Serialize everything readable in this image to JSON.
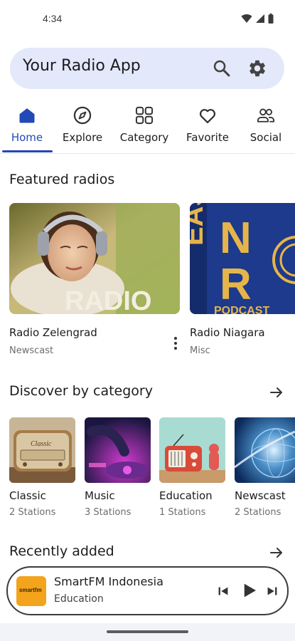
{
  "status_bar": {
    "time": "4:34",
    "icons": [
      "wifi-icon",
      "cell-signal-icon",
      "battery-icon"
    ]
  },
  "search": {
    "title": "Your Radio App",
    "icons": [
      "search-icon",
      "gear-icon"
    ]
  },
  "tabs": [
    {
      "label": "Home",
      "icon": "home-icon",
      "active": true
    },
    {
      "label": "Explore",
      "icon": "compass-icon",
      "active": false
    },
    {
      "label": "Category",
      "icon": "grid-icon",
      "active": false
    },
    {
      "label": "Favorite",
      "icon": "heart-icon",
      "active": false
    },
    {
      "label": "Social",
      "icon": "people-icon",
      "active": false
    }
  ],
  "featured": {
    "title": "Featured radios",
    "items": [
      {
        "name": "Radio Zelengrad",
        "category": "Newscast",
        "image_text": "RADIO"
      },
      {
        "name": "Radio Niagara",
        "category": "Misc",
        "image_text": "EAST N R PODCAST"
      }
    ]
  },
  "categories": {
    "title": "Discover by category",
    "items": [
      {
        "name": "Classic",
        "count": "2 Stations"
      },
      {
        "name": "Music",
        "count": "3 Stations"
      },
      {
        "name": "Education",
        "count": "1 Stations"
      },
      {
        "name": "Newscast",
        "count": "2 Stations"
      }
    ]
  },
  "recent": {
    "title": "Recently added"
  },
  "player": {
    "title": "SmartFM Indonesia",
    "subtitle": "Education",
    "art_text": "smartfm"
  },
  "colors": {
    "accent": "#2348b8",
    "search_bg": "#e3e9fa",
    "art_bg": "#f4a31c"
  }
}
